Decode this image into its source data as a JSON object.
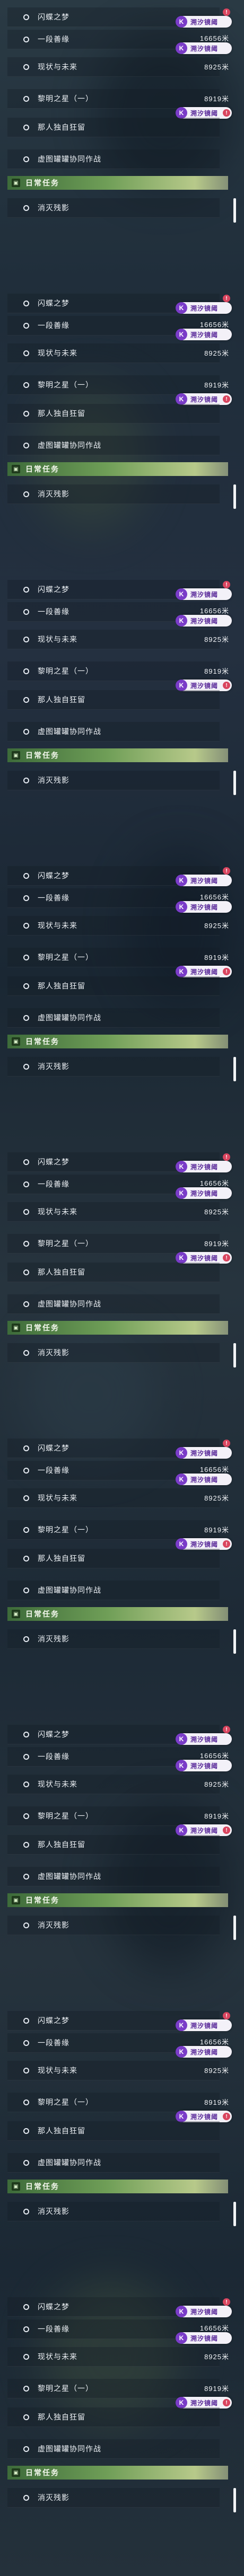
{
  "quests": {
    "q1": "闪蝶之梦",
    "q2": "一段善缘",
    "q3": "现状与未来",
    "q4": "黎明之星（一）",
    "q5": "那人独自狂留",
    "q6": "虚图罐罐协同作战"
  },
  "daily": {
    "title": "日常任务",
    "q1": "消灭残影"
  },
  "tag": {
    "icon": "K",
    "label": "溯汐镜阈"
  },
  "distances": {
    "d2": "16656米",
    "d3": "8925米",
    "d4": "8919米"
  },
  "mark_icon": "!",
  "colors": {
    "tag_purple": "#7a3cc8",
    "section_green": "#6f9e57",
    "mark_red": "#d9455f"
  }
}
